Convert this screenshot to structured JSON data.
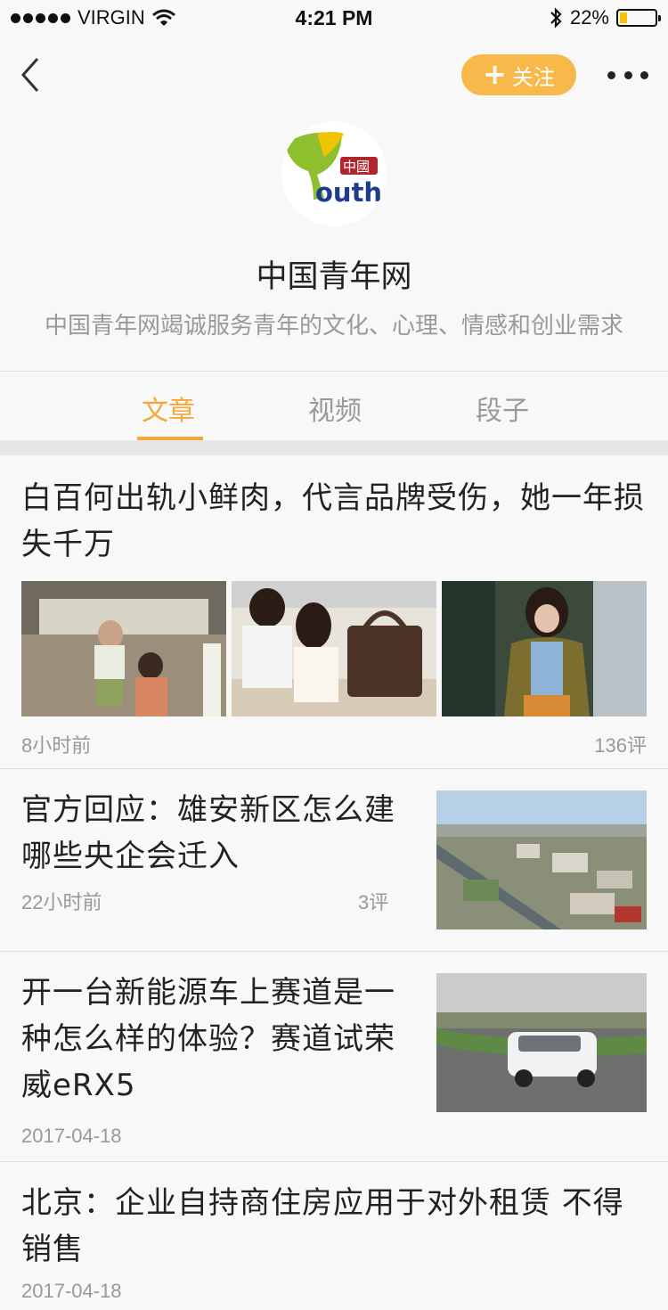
{
  "status_bar": {
    "carrier": "VIRGIN",
    "time": "4:21 PM",
    "battery": "22%",
    "battery_level": 0.22
  },
  "header": {
    "follow_label": "关注",
    "title": "中国青年网",
    "description": "中国青年网竭诚服务青年的文化、心理、情感和创业需求",
    "avatar_text": "outh",
    "avatar_small_text": "中國"
  },
  "tabs": [
    {
      "label": "文章",
      "active": true
    },
    {
      "label": "视频",
      "active": false
    },
    {
      "label": "段子",
      "active": false
    }
  ],
  "articles": [
    {
      "title": "白百何出轨小鲜肉，代言品牌受伤，她一年损失千万",
      "time": "8小时前",
      "comments": "136评"
    },
    {
      "title": "官方回应：雄安新区怎么建 哪些央企会迁入",
      "time": "22小时前",
      "comments": "3评"
    },
    {
      "title": "开一台新能源车上赛道是一种怎么样的体验？赛道试荣威eRX5",
      "time": "2017-04-18"
    },
    {
      "title": "北京：企业自持商住房应用于对外租赁  不得销售",
      "time": "2017-04-18"
    }
  ],
  "colors": {
    "accent": "#f5a83a",
    "follow_button": "#f9b84a"
  }
}
